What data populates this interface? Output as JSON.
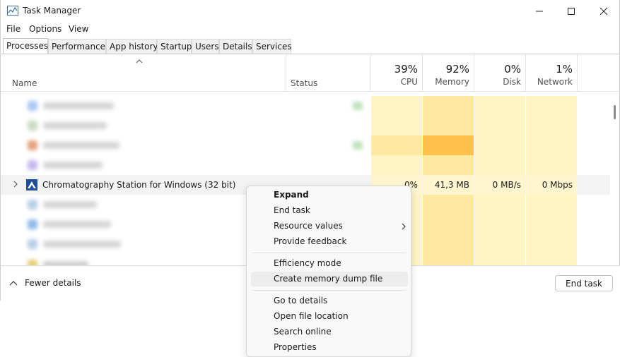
{
  "window": {
    "title": "Task Manager",
    "icons": {
      "app": "task-manager-icon",
      "minimize": "minimize-icon",
      "maximize": "maximize-icon",
      "close": "close-icon"
    }
  },
  "menu": {
    "file": "File",
    "options": "Options",
    "view": "View"
  },
  "tabs": [
    {
      "label": "Processes",
      "active": true
    },
    {
      "label": "Performance",
      "active": false
    },
    {
      "label": "App history",
      "active": false
    },
    {
      "label": "Startup",
      "active": false
    },
    {
      "label": "Users",
      "active": false
    },
    {
      "label": "Details",
      "active": false
    },
    {
      "label": "Services",
      "active": false
    }
  ],
  "columns": {
    "name": "Name",
    "status": "Status",
    "cpu": {
      "percent": "39%",
      "label": "CPU"
    },
    "memory": {
      "percent": "92%",
      "label": "Memory"
    },
    "disk": {
      "percent": "0%",
      "label": "Disk"
    },
    "network": {
      "percent": "1%",
      "label": "Network"
    }
  },
  "process": {
    "name": "Chromatography Station for Windows (32 bit)",
    "cpu": "0%",
    "memory": "41,3 MB",
    "disk": "0 MB/s",
    "network": "0 Mbps"
  },
  "footer": {
    "fewer_details": "Fewer details",
    "end_task": "End task"
  },
  "context_menu": {
    "expand": "Expand",
    "end_task": "End task",
    "resource_values": "Resource values",
    "provide_feedback": "Provide feedback",
    "efficiency_mode": "Efficiency mode",
    "create_dump": "Create memory dump file",
    "go_to_details": "Go to details",
    "open_file_location": "Open file location",
    "search_online": "Search online",
    "properties": "Properties"
  },
  "colors": {
    "heat_light": "#fff4c4",
    "heat_mid": "#ffe9a0",
    "heat_strong": "#ffd773",
    "heat_orange": "#ffc04c",
    "accent": "#1f4e9c"
  }
}
